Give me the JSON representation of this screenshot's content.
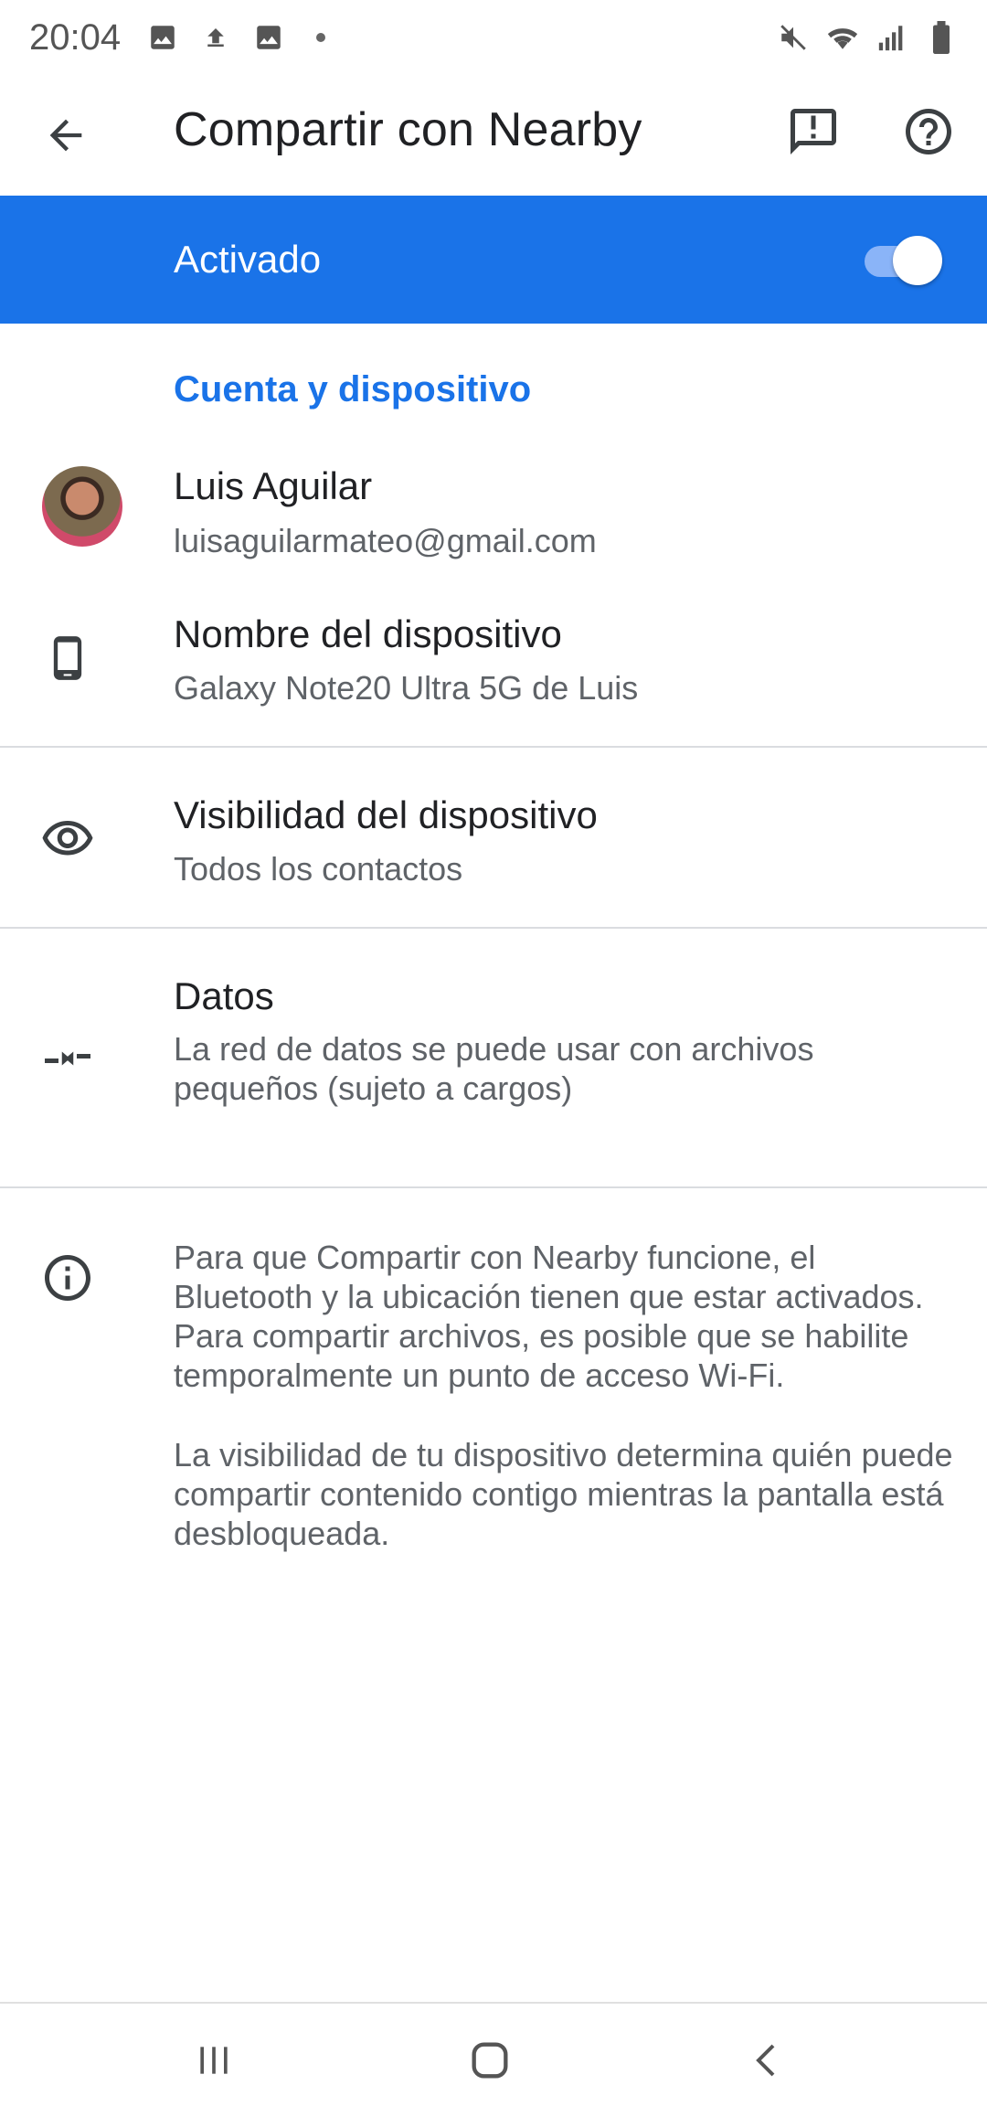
{
  "status_bar": {
    "time": "20:04",
    "left_icons": [
      "image-icon",
      "upload-icon",
      "image-icon",
      "dot-icon"
    ],
    "right_icons": [
      "mute-icon",
      "wifi-icon",
      "signal-icon",
      "battery-icon"
    ]
  },
  "app_bar": {
    "title": "Compartir con Nearby"
  },
  "master_toggle": {
    "label": "Activado",
    "state": "on",
    "accent_color": "#1a73e8"
  },
  "section": {
    "header": "Cuenta y dispositivo"
  },
  "account": {
    "name": "Luis Aguilar",
    "email": "luisaguilarmateo@gmail.com"
  },
  "device_name": {
    "title": "Nombre del dispositivo",
    "value": "Galaxy Note20 Ultra 5G de Luis"
  },
  "visibility": {
    "title": "Visibilidad del dispositivo",
    "value": "Todos los contactos"
  },
  "data": {
    "title": "Datos",
    "value": "La red de datos se puede usar con archivos pequeños (sujeto a cargos)"
  },
  "info": {
    "paragraph1": "Para que Compartir con Nearby funcione, el Bluetooth y la ubicación tienen que estar activados. Para compartir archivos, es posible que se habilite temporalmente un punto de acceso Wi-Fi.",
    "paragraph2": "La visibilidad de tu dispositivo determina quién puede compartir contenido contigo mientras la pantalla está desbloqueada."
  },
  "nav_bar": {
    "buttons": [
      "recents-icon",
      "home-icon",
      "back-icon"
    ]
  }
}
